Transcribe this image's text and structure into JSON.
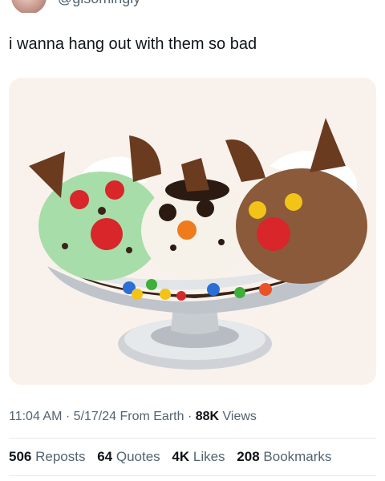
{
  "tweet": {
    "handle": "@glsomingly",
    "text": "i wanna hang out with them so bad",
    "image_alt_icons": [
      "ice-cream-sundae-image"
    ]
  },
  "meta": {
    "time": "11:04 AM",
    "sep1": " · ",
    "date": "5/17/24",
    "source": " From Earth",
    "sep2": " · ",
    "views_count": "88K",
    "views_label": " Views"
  },
  "stats": {
    "reposts_count": "506",
    "reposts_label": " Reposts",
    "quotes_count": "64",
    "quotes_label": " Quotes",
    "likes_count": "4K",
    "likes_label": " Likes",
    "bookmarks_count": "208",
    "bookmarks_label": " Bookmarks"
  },
  "colors": {
    "text_primary": "#0f1419",
    "text_secondary": "#536471",
    "divider": "#e7e9ea",
    "media_bg": "#f9f2ec"
  }
}
